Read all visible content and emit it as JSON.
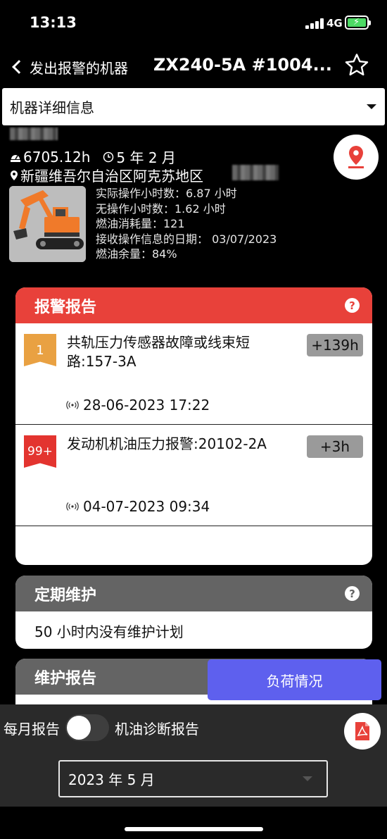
{
  "status_bar": {
    "time": "13:13",
    "network": "4G"
  },
  "nav": {
    "back_label": "发出报警的机器",
    "title": "ZX240-5A #1004..."
  },
  "dropdown": {
    "label": "机器详细信息"
  },
  "machine": {
    "hours": "6705.12h",
    "age": "5 年 2 月",
    "location": "新疆维吾尔自治区阿克苏地区",
    "ops": [
      "实际操作小时数：6.87 小时",
      "无操作小时数：1.62 小时",
      "燃油消耗量：121",
      "接收操作信息的日期： 03/07/2023",
      "燃油余量：84%"
    ]
  },
  "alarm_report": {
    "title": "报警报告",
    "items": [
      {
        "badge": "1",
        "text": "共轨压力传感器故障或线束短路:157-3A",
        "chip": "+139h",
        "time": "28-06-2023 17:22"
      },
      {
        "badge": "99+",
        "text": "发动机机油压力报警:20102-2A",
        "chip": "+3h",
        "time": "04-07-2023 09:34"
      }
    ]
  },
  "periodic_maintenance": {
    "title": "定期维护",
    "body": "50 小时内没有维护计划"
  },
  "maintenance_report": {
    "title": "维护报告"
  },
  "load_button": {
    "label": "负荷情况"
  },
  "bottom": {
    "monthly_label": "每月报告",
    "oil_label": "机油诊断报告",
    "month_value": "2023 年 5 月"
  },
  "colors": {
    "alarm_red": "#e8413a",
    "header_gray": "#646464",
    "load_blue": "#5e60ee",
    "badge_orange": "#e9a142"
  },
  "icons": [
    "back-chevron-icon",
    "star-icon",
    "chevron-down-icon",
    "hour-meter-icon",
    "clock-icon",
    "location-pin-icon",
    "map-pin-icon",
    "help-icon",
    "signal-icon",
    "pdf-icon"
  ]
}
